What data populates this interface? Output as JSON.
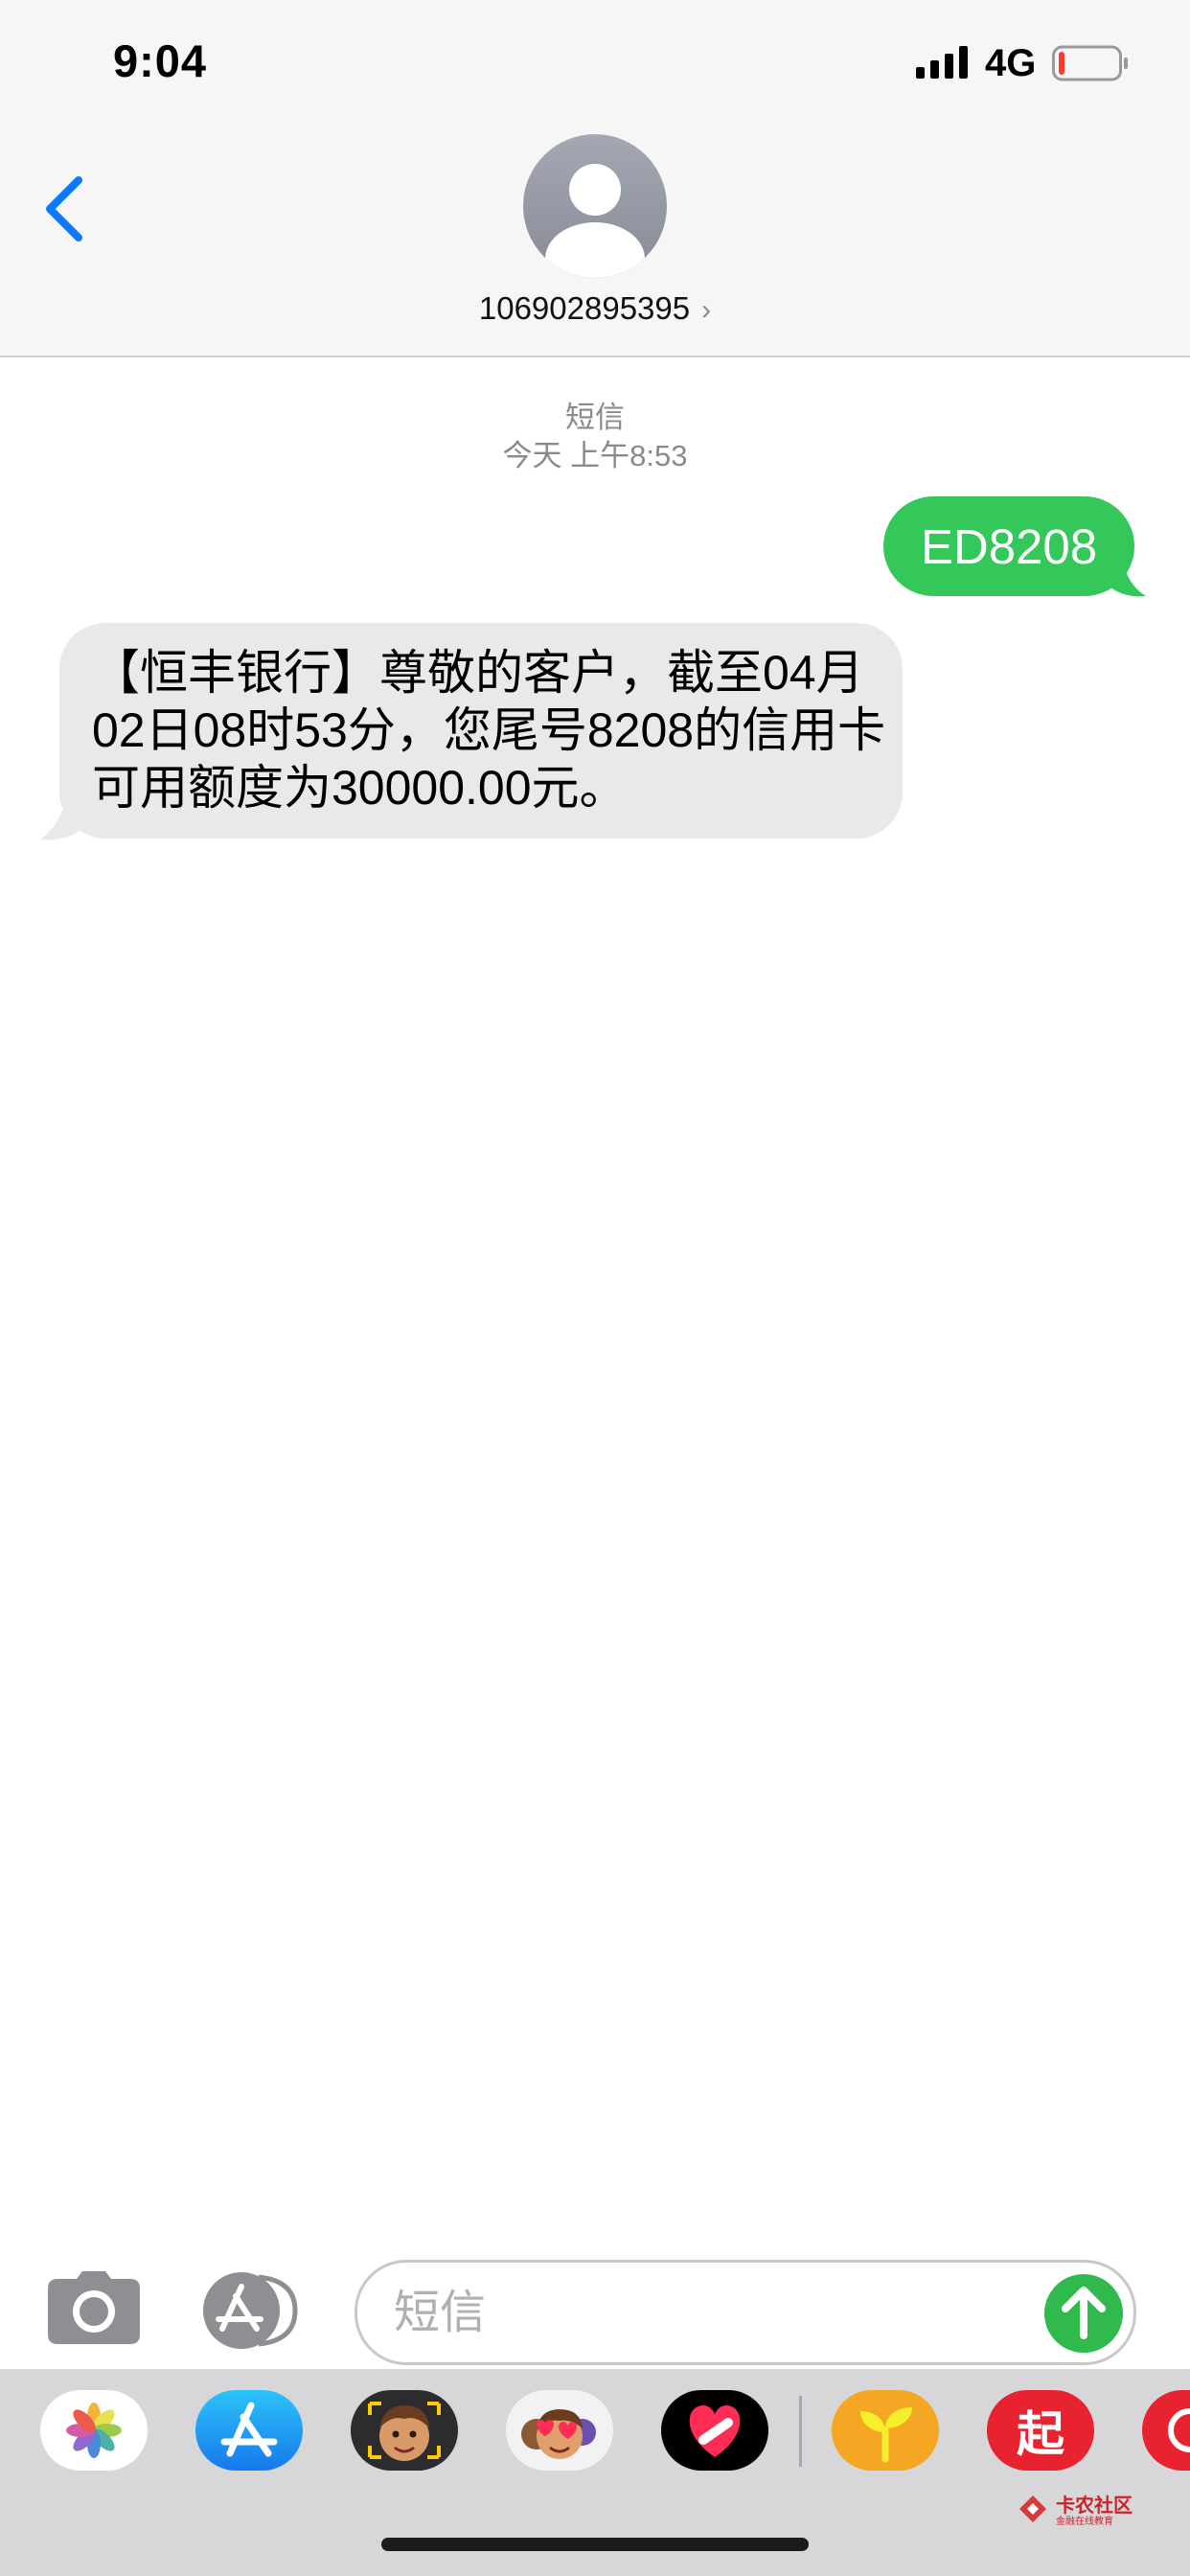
{
  "status_bar": {
    "time": "9:04",
    "network": "4G",
    "battery_level": 0.1,
    "battery_color": "#ff3b30"
  },
  "header": {
    "back_icon": "chevron-left-icon",
    "avatar_icon": "person-avatar-icon",
    "contact": "106902895395",
    "contact_chevron": "›",
    "accent_color": "#0a7aff"
  },
  "conversation": {
    "service_label": "短信",
    "timestamp": "今天 上午8:53",
    "messages": [
      {
        "direction": "outgoing",
        "text": "ED8208",
        "color": "#34c759"
      },
      {
        "direction": "incoming",
        "text": "【恒丰银行】尊敬的客户，截至04月02日08时53分，您尾号8208的信用卡可用额度为30000.00元。",
        "color": "#e9e9eb"
      }
    ]
  },
  "input_bar": {
    "camera_icon": "camera-icon",
    "apps_icon": "app-store-icon",
    "placeholder": "短信",
    "send_icon": "arrow-up-icon"
  },
  "app_drawer": {
    "apps": [
      {
        "name": "photos",
        "icon": "photos-icon"
      },
      {
        "name": "app-store",
        "icon": "app-store-icon"
      },
      {
        "name": "memoji",
        "icon": "memoji-icon"
      },
      {
        "name": "memoji-stickers",
        "icon": "memoji-stickers-icon"
      },
      {
        "name": "digital-touch",
        "icon": "digital-touch-icon"
      },
      {
        "name": "sprout",
        "icon": "sprout-icon"
      },
      {
        "name": "qi-app",
        "icon": "qi-app-icon",
        "label": "起"
      }
    ]
  },
  "watermark": {
    "text": "卡农社区",
    "subtext": "金融在线教育"
  }
}
